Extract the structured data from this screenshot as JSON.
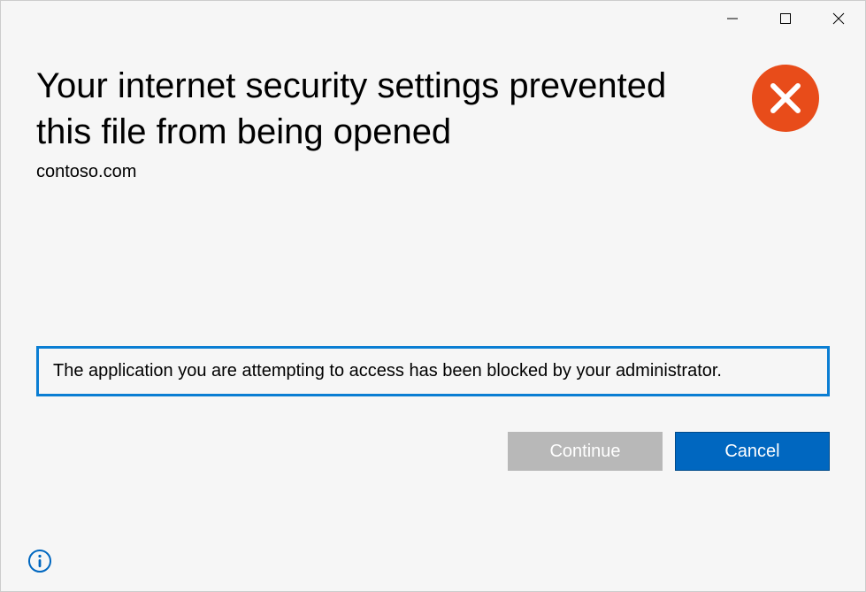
{
  "dialog": {
    "heading": "Your internet security settings prevented this file from being opened",
    "subheading": "contoso.com",
    "message": "The application you are attempting to access has been blocked by your administrator.",
    "buttons": {
      "continue": "Continue",
      "cancel": "Cancel"
    }
  },
  "colors": {
    "accent": "#0067c0",
    "highlight_border": "#0a7ed3",
    "error_icon": "#e84c1a",
    "info_icon": "#0067c0"
  }
}
